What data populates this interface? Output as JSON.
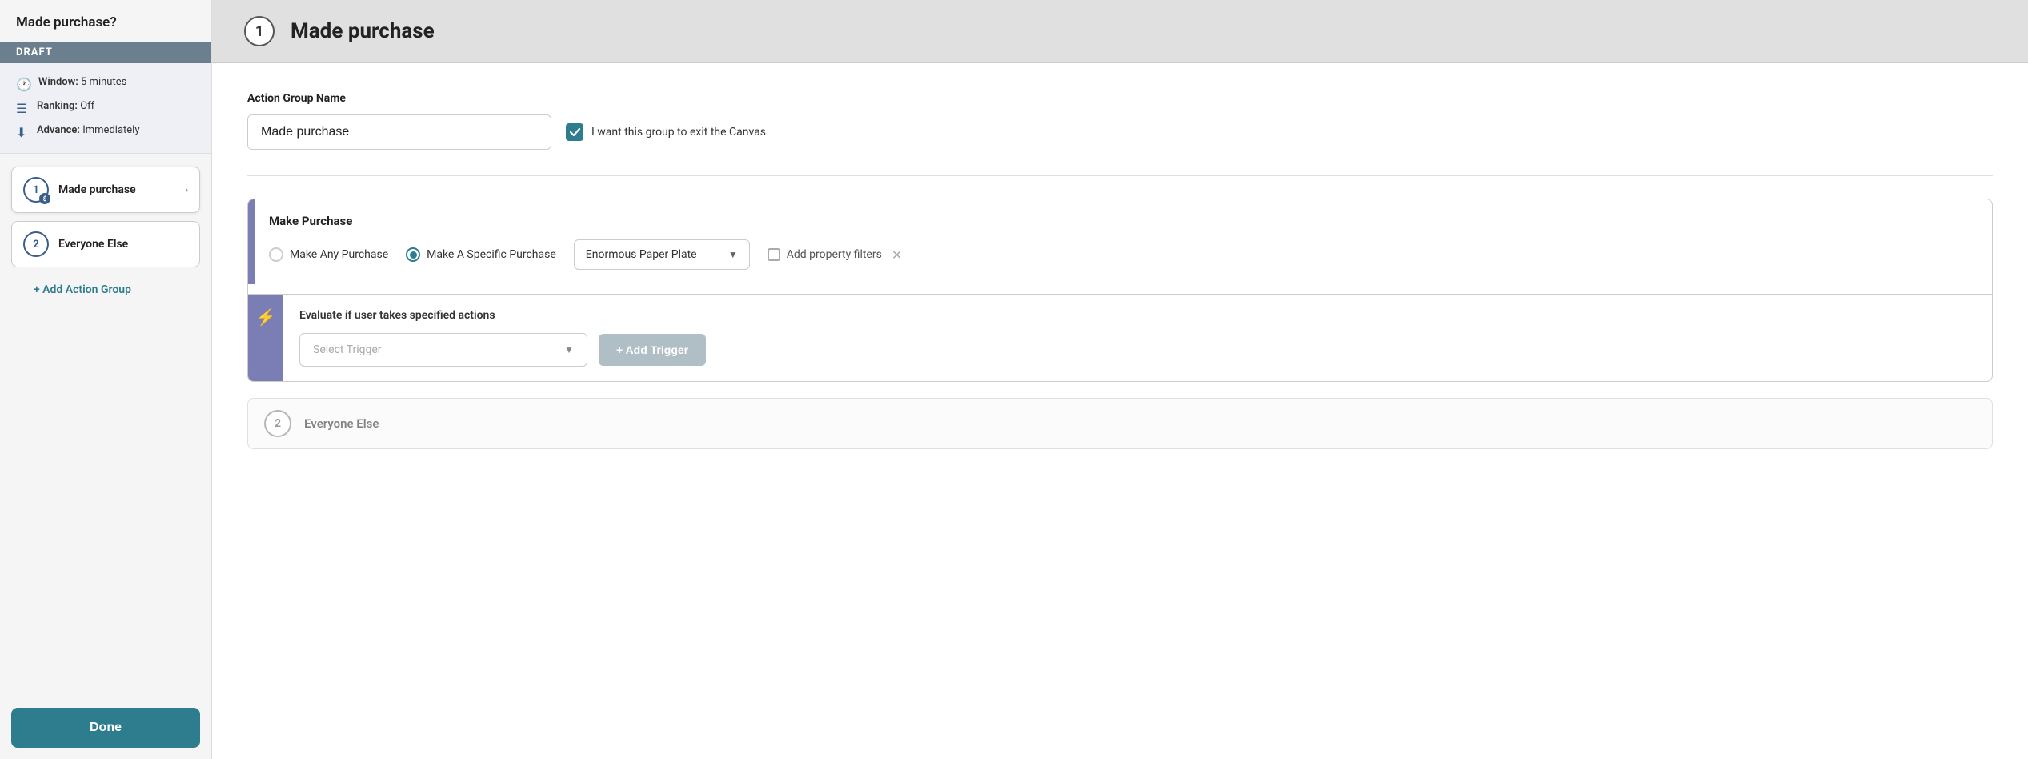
{
  "sidebar": {
    "title": "Made purchase?",
    "draft_label": "DRAFT",
    "meta": {
      "window_label": "Window:",
      "window_value": "5 minutes",
      "ranking_label": "Ranking:",
      "ranking_value": "Off",
      "advance_label": "Advance:",
      "advance_value": "Immediately"
    },
    "groups": [
      {
        "number": "1",
        "label": "Made purchase",
        "active": true
      },
      {
        "number": "2",
        "label": "Everyone Else",
        "active": false
      }
    ],
    "add_group_label": "+ Add Action Group",
    "done_label": "Done"
  },
  "main": {
    "header": {
      "number": "1",
      "title": "Made purchase"
    },
    "action_group_name_label": "Action Group Name",
    "action_group_name_value": "Made purchase",
    "exit_canvas_label": "I want this group to exit the Canvas",
    "purchase_card": {
      "title": "Make Purchase",
      "radio_any": "Make Any Purchase",
      "radio_specific": "Make A Specific Purchase",
      "product_name": "Enormous Paper Plate",
      "prop_filter_label": "Add property filters"
    },
    "trigger_section": {
      "title": "Evaluate if user takes specified actions",
      "select_placeholder": "Select Trigger",
      "add_trigger_label": "+ Add Trigger"
    },
    "everyone_card": {
      "number": "2",
      "label": "Everyone Else"
    }
  }
}
